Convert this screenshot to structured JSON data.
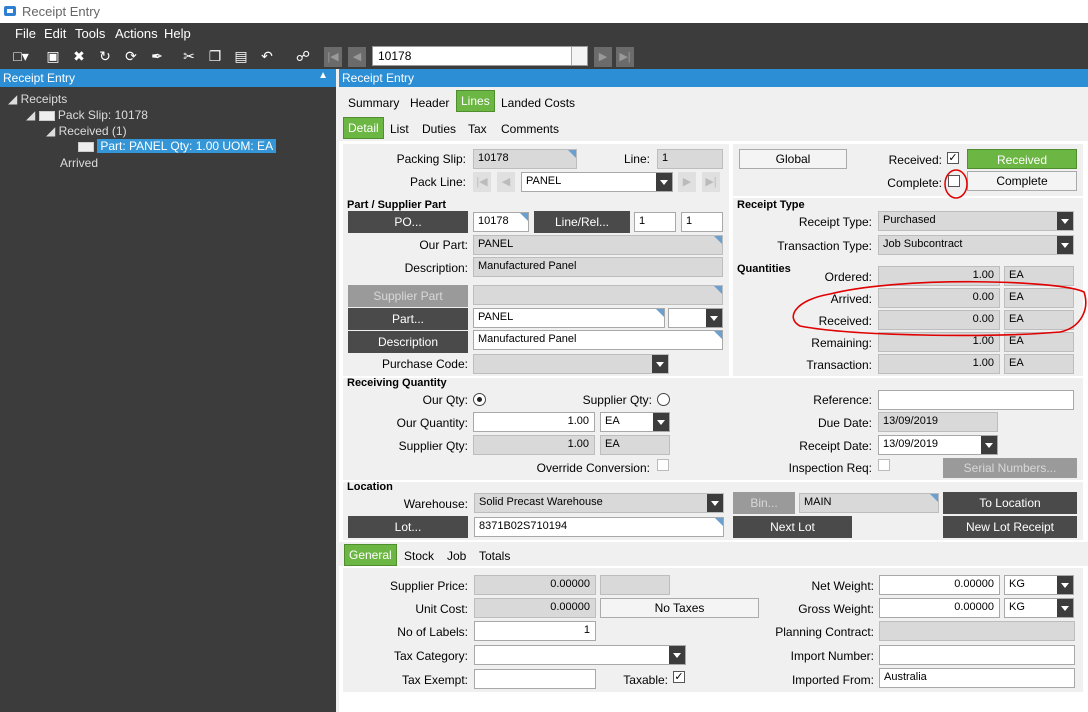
{
  "window": {
    "title": "Receipt Entry"
  },
  "menu": [
    "File",
    "Edit",
    "Tools",
    "Actions",
    "Help"
  ],
  "toolbar": {
    "record": "10178"
  },
  "left_pane": {
    "title": "Receipt Entry",
    "tree": {
      "root": "Receipts",
      "pack_slip": "Pack Slip: 10178",
      "received": "Received (1)",
      "part": "Part: PANEL Qty: 1.00 UOM: EA",
      "arrived": "Arrived"
    }
  },
  "main": {
    "title": "Receipt Entry",
    "tabs": [
      "Summary",
      "Header",
      "Lines",
      "Landed Costs"
    ],
    "active_tab": "Lines",
    "subtabs": [
      "Detail",
      "List",
      "Duties",
      "Tax",
      "Comments"
    ],
    "active_subtab": "Detail"
  },
  "detail": {
    "packing_slip_label": "Packing Slip:",
    "packing_slip": "10178",
    "line_label": "Line:",
    "line": "1",
    "pack_line_label": "Pack Line:",
    "pack_line": "PANEL",
    "part_section": "Part / Supplier Part",
    "po_button": "PO...",
    "po_num": "10178",
    "line_rel_button": "Line/Rel...",
    "line_num": "1",
    "rel_num": "1",
    "our_part_label": "Our Part:",
    "our_part": "PANEL",
    "description_label": "Description:",
    "description": "Manufactured Panel",
    "supplier_part_button": "Supplier Part",
    "part_button": "Part...",
    "part": "PANEL",
    "description_button": "Description",
    "description2": "Manufactured Panel",
    "purchase_code_label": "Purchase Code:",
    "global_button": "Global",
    "received_label": "Received:",
    "received_checked": "✓",
    "received_button": "Received",
    "complete_label": "Complete:",
    "complete_button": "Complete",
    "receipt_type_section": "Receipt Type",
    "receipt_type_label": "Receipt Type:",
    "receipt_type": "Purchased",
    "transaction_type_label": "Transaction Type:",
    "transaction_type": "Job Subcontract",
    "quantities_section": "Quantities",
    "qty_rows": [
      {
        "label": "Ordered:",
        "value": "1.00",
        "uom": "EA"
      },
      {
        "label": "Arrived:",
        "value": "0.00",
        "uom": "EA"
      },
      {
        "label": "Received:",
        "value": "0.00",
        "uom": "EA"
      },
      {
        "label": "Remaining:",
        "value": "1.00",
        "uom": "EA"
      },
      {
        "label": "Transaction:",
        "value": "1.00",
        "uom": "EA"
      }
    ],
    "receiving_section": "Receiving Quantity",
    "our_qty_label": "Our Qty:",
    "supplier_qty_radio_label": "Supplier Qty:",
    "our_quantity_label": "Our Quantity:",
    "our_quantity": "1.00",
    "our_uom": "EA",
    "supplier_qty_label": "Supplier Qty:",
    "supplier_qty": "1.00",
    "supplier_uom": "EA",
    "override_label": "Override Conversion:",
    "reference_label": "Reference:",
    "due_date_label": "Due Date:",
    "due_date": "13/09/2019",
    "receipt_date_label": "Receipt Date:",
    "receipt_date": "13/09/2019",
    "inspection_label": "Inspection Req:",
    "serial_button": "Serial Numbers...",
    "location_section": "Location",
    "warehouse_label": "Warehouse:",
    "warehouse": "Solid Precast Warehouse",
    "bin_button": "Bin...",
    "bin": "MAIN",
    "to_location_button": "To Location",
    "lot_button": "Lot...",
    "lot": "8371B02S710194",
    "next_lot_button": "Next Lot",
    "new_lot_button": "New Lot Receipt"
  },
  "bottom": {
    "tabs": [
      "General",
      "Stock",
      "Job",
      "Totals"
    ],
    "active_tab": "General",
    "supplier_price_label": "Supplier Price:",
    "supplier_price": "0.00000",
    "unit_cost_label": "Unit Cost:",
    "unit_cost": "0.00000",
    "no_taxes_button": "No Taxes",
    "labels_label": "No of Labels:",
    "labels": "1",
    "tax_category_label": "Tax Category:",
    "tax_exempt_label": "Tax Exempt:",
    "taxable_label": "Taxable:",
    "taxable_checked": "✓",
    "net_weight_label": "Net Weight:",
    "net_weight": "0.00000",
    "net_uom": "KG",
    "gross_weight_label": "Gross Weight:",
    "gross_weight": "0.00000",
    "gross_uom": "KG",
    "planning_label": "Planning Contract:",
    "import_number_label": "Import Number:",
    "imported_from_label": "Imported From:",
    "imported_from": "Australia"
  },
  "colors": {
    "accent": "#2c8fd6",
    "active_green": "#6cb643",
    "annotation_red": "#e00000"
  }
}
